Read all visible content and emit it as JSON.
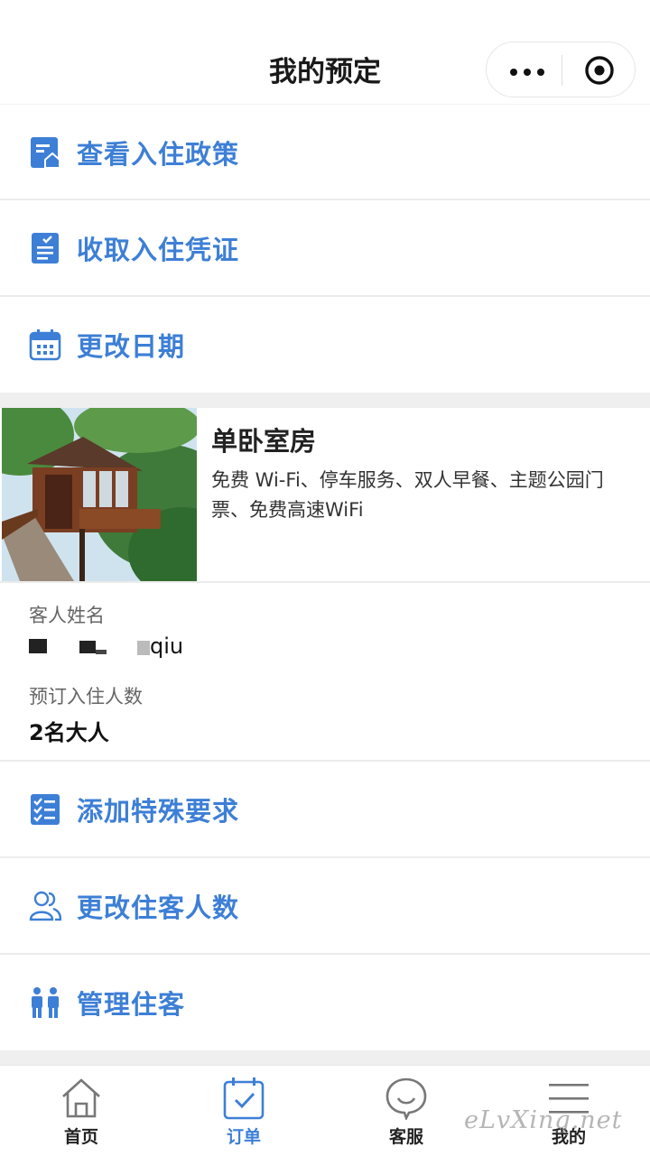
{
  "header": {
    "title": "我的预定"
  },
  "actions_top": [
    {
      "label": "查看入住政策",
      "icon": "policy-document-icon"
    },
    {
      "label": "收取入住凭证",
      "icon": "voucher-checklist-icon"
    },
    {
      "label": "更改日期",
      "icon": "calendar-icon"
    }
  ],
  "room": {
    "name": "单卧室房",
    "amenities": "免费 Wi-Fi、停车服务、双人早餐、主题公园门票、免费高速WiFi"
  },
  "guest": {
    "name_label": "客人姓名",
    "name_value": "qiu",
    "count_label": "预订入住人数",
    "count_value": "2名大人"
  },
  "actions_bottom": [
    {
      "label": "添加特殊要求",
      "icon": "checklist-icon"
    },
    {
      "label": "更改住客人数",
      "icon": "users-icon"
    },
    {
      "label": "管理住客",
      "icon": "two-people-icon"
    }
  ],
  "tabbar": [
    {
      "label": "首页",
      "icon": "home-icon",
      "active": false
    },
    {
      "label": "订单",
      "icon": "order-check-icon",
      "active": true
    },
    {
      "label": "客服",
      "icon": "chat-bubble-icon",
      "active": false
    },
    {
      "label": "我的",
      "icon": "menu-lines-icon",
      "active": false
    }
  ],
  "watermark": "eLvXing.net",
  "colors": {
    "accent": "#3d7fd6",
    "text": "#222222",
    "divider": "#ececec",
    "section_gap": "#efefef"
  }
}
